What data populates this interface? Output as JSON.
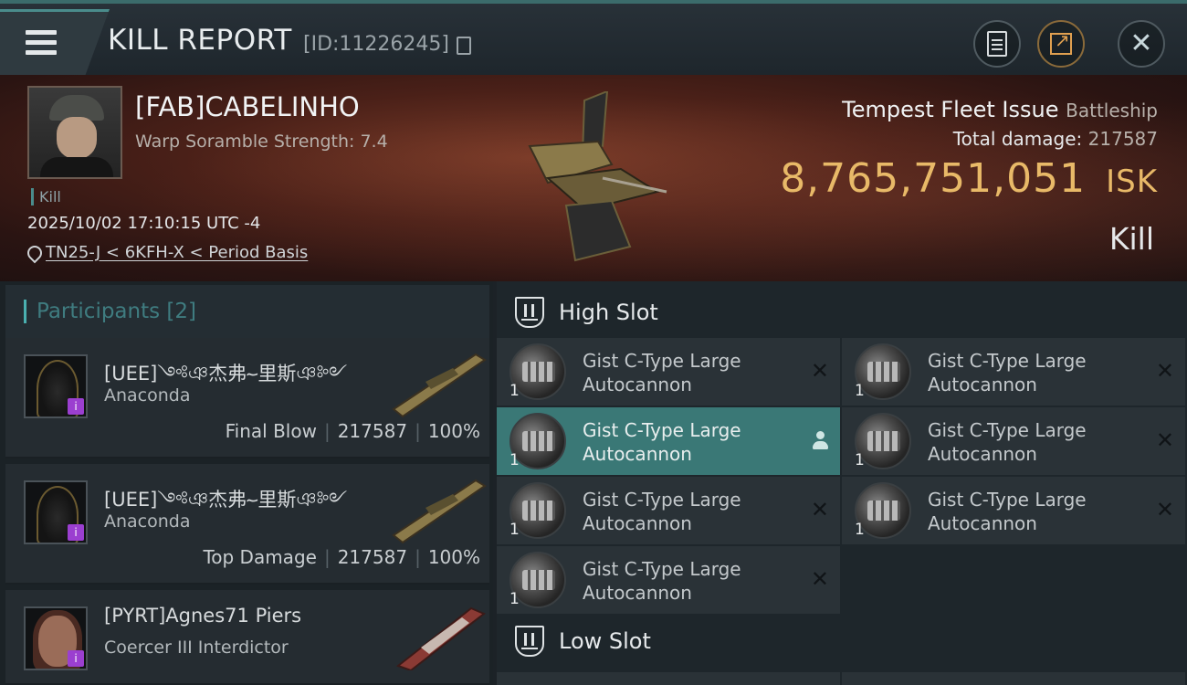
{
  "header": {
    "title": "KILL REPORT",
    "report_id": "[ID:11226245]"
  },
  "victim": {
    "name": "[FAB]CABELINHO",
    "warp_scramble": "Warp Soramble Strength: 7.4",
    "kill_tag": "Kill",
    "timestamp": "2025/10/02 17:10:15 UTC -4",
    "location": "TN25-J < 6KFH-X < Period Basis",
    "ship_name": "Tempest Fleet Issue",
    "ship_class": "Battleship",
    "total_damage_label": "Total damage:",
    "total_damage": "217587",
    "isk_value": "8,765,751,051",
    "isk_unit": "ISK",
    "result": "Kill"
  },
  "participants": {
    "title": "Participants [2]",
    "items": [
      {
        "name": "[UEE]༺ঞ杰弗؅里斯ঞ༻",
        "ship": "Anaconda",
        "role": "Final Blow",
        "damage": "217587",
        "percent": "100%"
      },
      {
        "name": "[UEE]༺ঞ杰弗؅里斯ঞ༻",
        "ship": "Anaconda",
        "role": "Top Damage",
        "damage": "217587",
        "percent": "100%"
      },
      {
        "name": "[PYRT]Agnes71 Piers",
        "ship": "Coercer III Interdictor"
      }
    ]
  },
  "fitting": {
    "high_slot_label": "High Slot",
    "low_slot_label": "Low Slot",
    "high_modules": [
      {
        "name": "Gist C-Type Large Autocannon",
        "qty": "1"
      },
      {
        "name": "Gist C-Type Large Autocannon",
        "qty": "1"
      },
      {
        "name": "Gist C-Type Large Autocannon",
        "qty": "1"
      },
      {
        "name": "Gist C-Type Large Autocannon",
        "qty": "1"
      },
      {
        "name": "Gist C-Type Large Autocannon",
        "qty": "1"
      },
      {
        "name": "Gist C-Type Large Autocannon",
        "qty": "1"
      },
      {
        "name": "Gist C-Type Large Autocannon",
        "qty": "1"
      }
    ]
  },
  "colors": {
    "accent": "#4ab0b0",
    "isk": "#e8b968",
    "active_module": "#3a7876"
  }
}
